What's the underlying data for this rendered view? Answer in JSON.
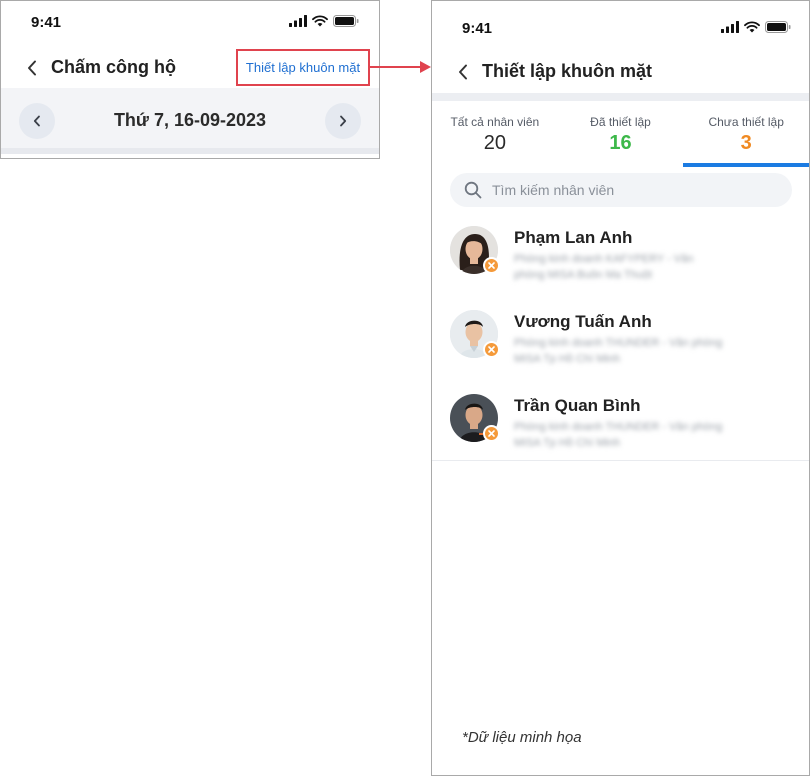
{
  "left_screen": {
    "status_time": "9:41",
    "title": "Chấm công hộ",
    "face_setup_link": "Thiết lập khuôn mặt",
    "date": "Thứ 7, 16-09-2023"
  },
  "right_screen": {
    "status_time": "9:41",
    "title": "Thiết lập khuôn mặt",
    "tabs": [
      {
        "label": "Tất cả nhân viên",
        "count": "20"
      },
      {
        "label": "Đã thiết lập",
        "count": "16"
      },
      {
        "label": "Chưa thiết lập",
        "count": "3",
        "active": true
      }
    ],
    "search": {
      "placeholder": "Tìm kiếm nhân viên"
    },
    "employees": [
      {
        "name": "Phạm Lan Anh",
        "dept": "Phòng kinh doanh KAFYPERY - Văn phòng MISA Buôn Ma Thuột"
      },
      {
        "name": "Vương Tuấn Anh",
        "dept": "Phòng kinh doanh THUNDER - Văn phòng MISA Tp Hồ Chí Minh"
      },
      {
        "name": "Trần Quan Bình",
        "dept": "Phòng kinh doanh THUNDER - Văn phòng MISA Tp Hồ Chí Minh"
      }
    ],
    "footnote": "*Dữ liệu minh họa"
  },
  "colors": {
    "link_blue": "#1f6fd1",
    "highlight_red": "#e0434e",
    "tab_underline": "#1b7be2",
    "count_green": "#3db84a",
    "count_orange": "#f08a22",
    "badge_orange": "#f59a3a"
  },
  "icons": [
    "signal-icon",
    "wifi-icon",
    "battery-icon",
    "back-chevron-icon",
    "chevron-left-icon",
    "chevron-right-icon",
    "search-icon",
    "not-setup-x-icon"
  ]
}
